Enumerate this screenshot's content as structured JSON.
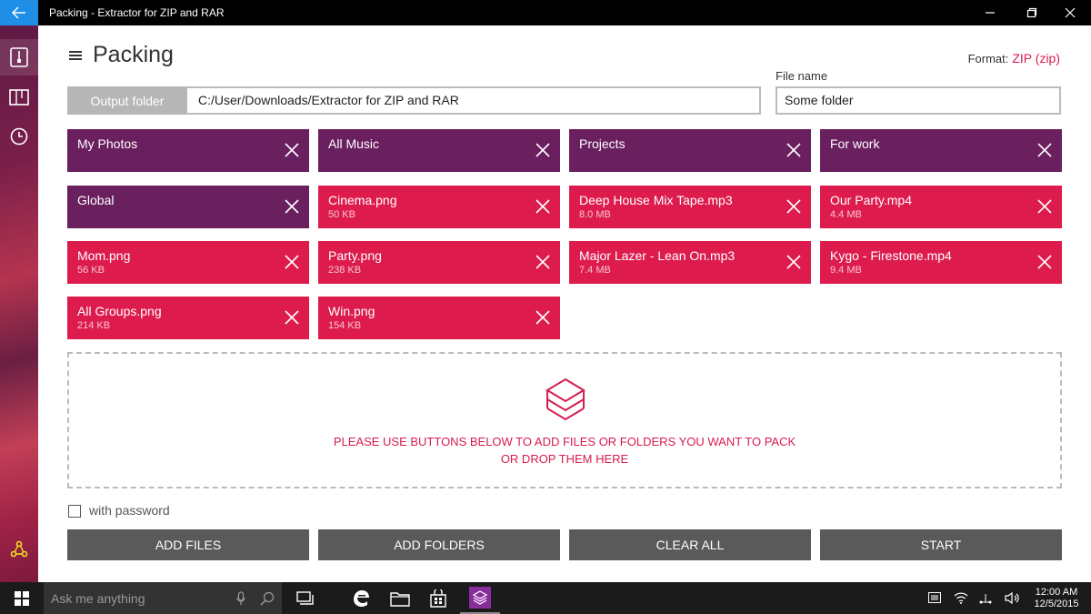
{
  "window": {
    "title": "Packing - Extractor for ZIP and RAR"
  },
  "page": {
    "title": "Packing",
    "format_label": "Format:",
    "format_value": "ZIP (zip)",
    "filename_label": "File name"
  },
  "output": {
    "button_label": "Output folder",
    "path": "C:/User/Downloads/Extractor for ZIP and RAR",
    "filename": "Some folder"
  },
  "items": [
    {
      "name": "My Photos",
      "size": "",
      "kind": "group"
    },
    {
      "name": "All Music",
      "size": "",
      "kind": "group"
    },
    {
      "name": "Projects",
      "size": "",
      "kind": "group"
    },
    {
      "name": "For work",
      "size": "",
      "kind": "group"
    },
    {
      "name": "Global",
      "size": "",
      "kind": "group"
    },
    {
      "name": "Cinema.png",
      "size": "50 KB",
      "kind": "file"
    },
    {
      "name": "Deep House Mix Tape.mp3",
      "size": "8.0 MB",
      "kind": "file"
    },
    {
      "name": "Our Party.mp4",
      "size": "4.4 MB",
      "kind": "file"
    },
    {
      "name": "Mom.png",
      "size": "56 KB",
      "kind": "file"
    },
    {
      "name": "Party.png",
      "size": "238 KB",
      "kind": "file"
    },
    {
      "name": "Major Lazer - Lean On.mp3",
      "size": "7.4 MB",
      "kind": "file"
    },
    {
      "name": "Kygo - Firestone.mp4",
      "size": "9.4 MB",
      "kind": "file"
    },
    {
      "name": "All Groups.png",
      "size": "214 KB",
      "kind": "file"
    },
    {
      "name": "Win.png",
      "size": "154 KB",
      "kind": "file"
    }
  ],
  "dropzone": {
    "line1": "PLEASE USE BUTTONS BELOW TO ADD FILES OR FOLDERS YOU WANT TO PACK",
    "line2": "OR DROP THEM HERE"
  },
  "password": {
    "label": "with password",
    "checked": false
  },
  "actions": {
    "add_files": "ADD FILES",
    "add_folders": "ADD FOLDERS",
    "clear_all": "CLEAR ALL",
    "start": "START"
  },
  "taskbar": {
    "search_placeholder": "Ask me anything",
    "time": "12:00 AM",
    "date": "12/5/2015"
  },
  "colors": {
    "group_tile": "#6a1f5f",
    "file_tile": "#dd1c4d",
    "accent": "#d81b50",
    "button": "#5a5a5a",
    "back_button": "#1e8ee6"
  }
}
